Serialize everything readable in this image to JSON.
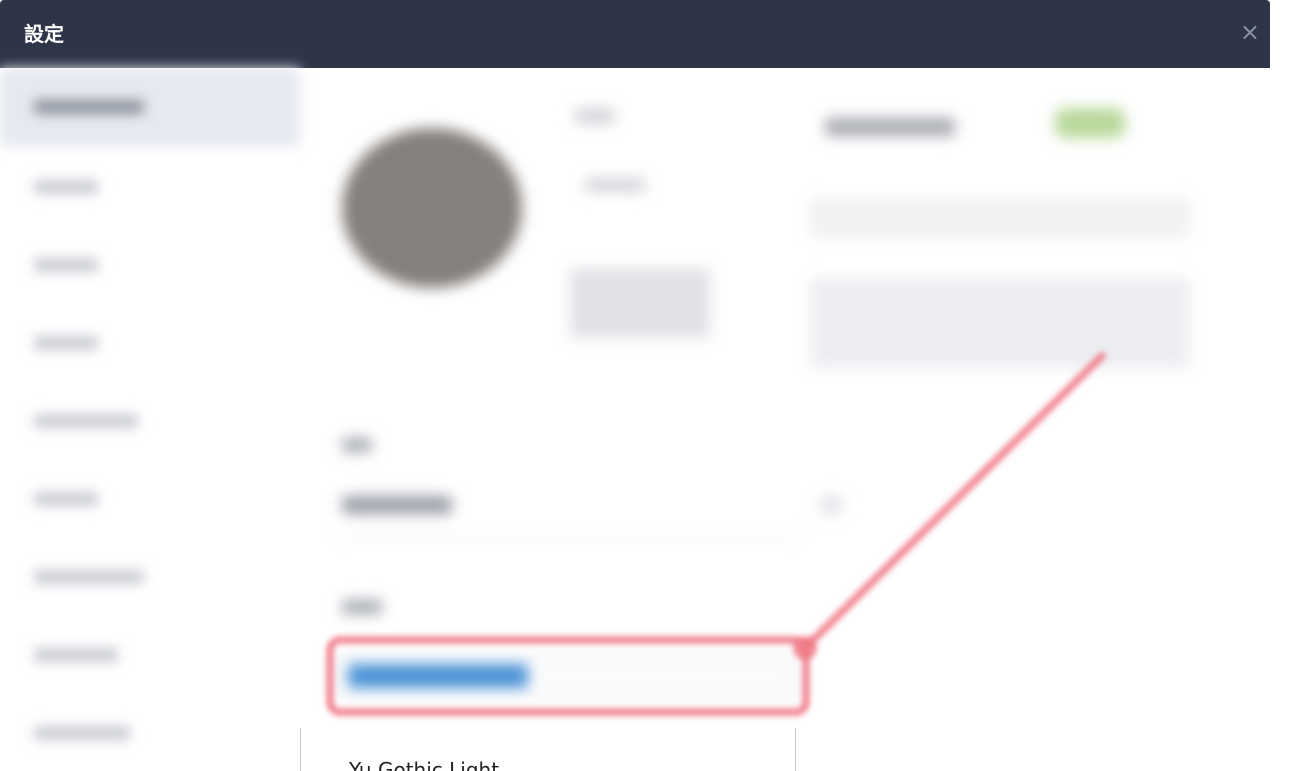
{
  "dialog": {
    "title": "設定",
    "close_glyph": "×"
  },
  "font_dropdown": {
    "visible_option": "Yu Gothic Light"
  },
  "colors": {
    "titlebar": "#2e3547",
    "annotation": "#f07a86",
    "selection": "#4a93d6"
  }
}
